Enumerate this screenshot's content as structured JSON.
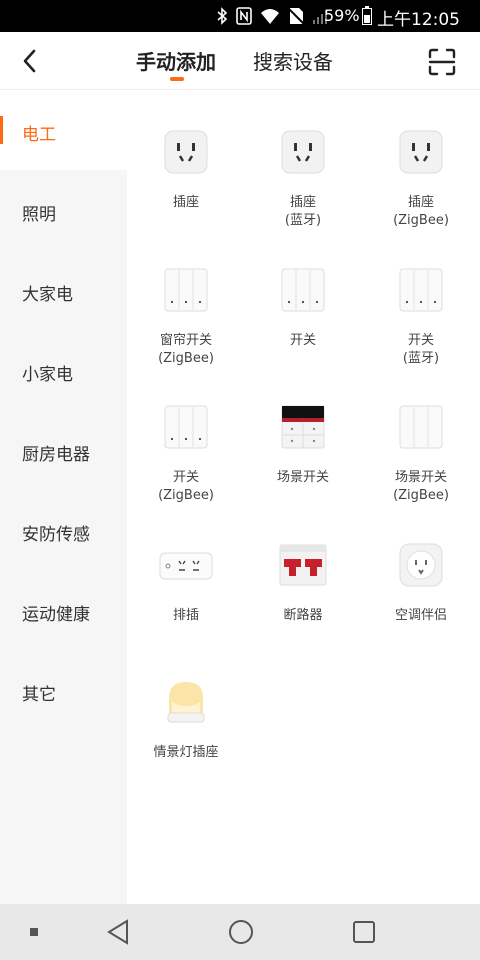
{
  "status_bar": {
    "battery_percent": "59%",
    "time": "上午12:05"
  },
  "header": {
    "tabs": [
      {
        "label": "手动添加",
        "active": true
      },
      {
        "label": "搜索设备",
        "active": false
      }
    ],
    "accent_color": "#ff6a13"
  },
  "sidebar": {
    "items": [
      {
        "label": "电工",
        "active": true
      },
      {
        "label": "照明"
      },
      {
        "label": "大家电"
      },
      {
        "label": "小家电"
      },
      {
        "label": "厨房电器"
      },
      {
        "label": "安防传感"
      },
      {
        "label": "运动健康"
      },
      {
        "label": "其它"
      }
    ]
  },
  "devices": [
    {
      "name": "插座",
      "icon": "socket-icon"
    },
    {
      "name": "插座\n(蓝牙)",
      "icon": "socket-icon"
    },
    {
      "name": "插座\n(ZigBee)",
      "icon": "socket-icon"
    },
    {
      "name": "窗帘开关\n(ZigBee)",
      "icon": "triple-switch-icon"
    },
    {
      "name": "开关",
      "icon": "triple-switch-icon"
    },
    {
      "name": "开关\n(蓝牙)",
      "icon": "triple-switch-icon"
    },
    {
      "name": "开关\n(ZigBee)",
      "icon": "triple-switch-icon"
    },
    {
      "name": "场景开关",
      "icon": "scene-switch-icon"
    },
    {
      "name": "场景开关\n(ZigBee)",
      "icon": "triple-switch-icon"
    },
    {
      "name": "排插",
      "icon": "power-strip-icon"
    },
    {
      "name": "断路器",
      "icon": "circuit-breaker-icon"
    },
    {
      "name": "空调伴侣",
      "icon": "ac-companion-icon"
    },
    {
      "name": "情景灯插座",
      "icon": "night-light-icon"
    }
  ]
}
